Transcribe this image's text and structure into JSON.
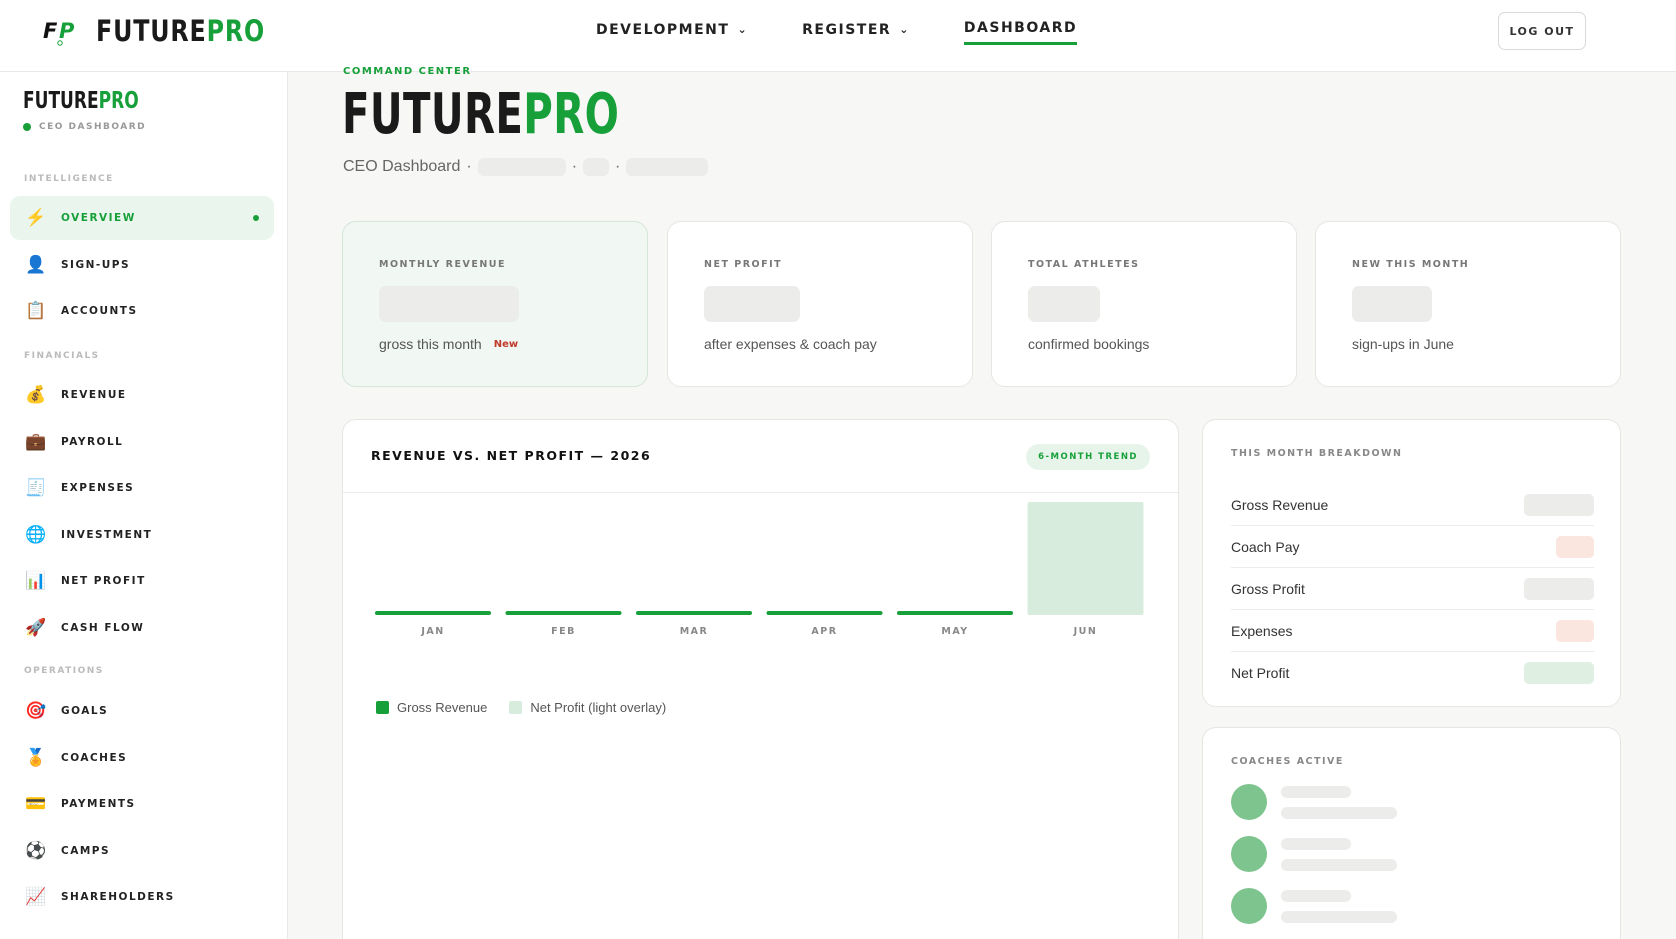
{
  "header": {
    "logo_mark": "FP",
    "logo_primary": "FUTURE",
    "logo_accent": "PRO",
    "nav": [
      {
        "label": "DEVELOPMENT",
        "has_dropdown": true,
        "active": false
      },
      {
        "label": "REGISTER",
        "has_dropdown": true,
        "active": false
      },
      {
        "label": "DASHBOARD",
        "has_dropdown": false,
        "active": true
      }
    ],
    "logout_label": "LOG OUT"
  },
  "sidebar": {
    "brand_primary": "FUTURE",
    "brand_accent": "PRO",
    "brand_sub": "CEO DASHBOARD",
    "sections": [
      {
        "label": "INTELLIGENCE",
        "items": [
          {
            "label": "OVERVIEW",
            "icon": "lightning-icon",
            "glyph": "⚡",
            "active": true
          },
          {
            "label": "SIGN-UPS",
            "icon": "person-icon",
            "glyph": "👤",
            "active": false
          },
          {
            "label": "ACCOUNTS",
            "icon": "ledger-icon",
            "glyph": "📋",
            "active": false
          }
        ]
      },
      {
        "label": "FINANCIALS",
        "items": [
          {
            "label": "REVENUE",
            "icon": "money-bag-icon",
            "glyph": "💰",
            "active": false
          },
          {
            "label": "PAYROLL",
            "icon": "briefcase-icon",
            "glyph": "💼",
            "active": false
          },
          {
            "label": "EXPENSES",
            "icon": "receipt-icon",
            "glyph": "🧾",
            "active": false
          },
          {
            "label": "INVESTMENT",
            "icon": "globe-icon",
            "glyph": "🌐",
            "active": false
          },
          {
            "label": "NET PROFIT",
            "icon": "bar-chart-icon",
            "glyph": "📊",
            "active": false
          },
          {
            "label": "CASH FLOW",
            "icon": "rocket-icon",
            "glyph": "🚀",
            "active": false
          }
        ]
      },
      {
        "label": "OPERATIONS",
        "items": [
          {
            "label": "GOALS",
            "icon": "target-icon",
            "glyph": "🎯",
            "active": false
          },
          {
            "label": "COACHES",
            "icon": "medal-icon",
            "glyph": "🏅",
            "active": false
          },
          {
            "label": "PAYMENTS",
            "icon": "credit-card-icon",
            "glyph": "💳",
            "active": false
          },
          {
            "label": "CAMPS",
            "icon": "soccer-ball-icon",
            "glyph": "⚽",
            "active": false
          },
          {
            "label": "SHAREHOLDERS",
            "icon": "trend-chart-icon",
            "glyph": "📈",
            "active": false
          }
        ]
      }
    ]
  },
  "main": {
    "kicker": "COMMAND CENTER",
    "title_primary": "FUTURE",
    "title_accent": "PRO",
    "subtitle": "CEO Dashboard",
    "separator": "·"
  },
  "stats": [
    {
      "label": "MONTHLY REVENUE",
      "note": "gross this month",
      "badge": "New"
    },
    {
      "label": "NET PROFIT",
      "note": "after expenses & coach pay",
      "badge": ""
    },
    {
      "label": "TOTAL ATHLETES",
      "note": "confirmed bookings",
      "badge": ""
    },
    {
      "label": "NEW THIS MONTH",
      "note": "sign-ups in June",
      "badge": ""
    }
  ],
  "chart": {
    "title": "REVENUE VS. NET PROFIT — 2026",
    "badge": "6-MONTH TREND"
  },
  "chart_data": {
    "type": "bar",
    "title": "REVENUE VS. NET PROFIT — 2026",
    "categories": [
      "JAN",
      "FEB",
      "MAR",
      "APR",
      "MAY",
      "JUN"
    ],
    "series": [
      {
        "name": "Gross Revenue",
        "values": [
          0.03,
          0.03,
          0.03,
          0.03,
          0.03,
          0.0
        ],
        "color": "#17a03a"
      },
      {
        "name": "Net Profit (light overlay)",
        "values": [
          0,
          0,
          0,
          0,
          0,
          1.0
        ],
        "color": "#d8ecdd"
      }
    ],
    "ylim": [
      0,
      1
    ],
    "grid": false,
    "legend": "bottom-left"
  },
  "breakdown": {
    "label": "THIS MONTH BREAKDOWN",
    "rows": [
      {
        "label": "Gross Revenue",
        "tone": "#ececea"
      },
      {
        "label": "Coach Pay",
        "tone": "#fbe5df"
      },
      {
        "label": "Gross Profit",
        "tone": "#ececea"
      },
      {
        "label": "Expenses",
        "tone": "#fbe5df"
      },
      {
        "label": "Net Profit",
        "tone": "#dff0e3"
      }
    ]
  },
  "coaches": {
    "label": "COACHES ACTIVE",
    "count_shown": 3
  },
  "colors": {
    "accent": "#17a03a",
    "accent_light": "#eaf6ed",
    "warn": "#c0392b"
  }
}
